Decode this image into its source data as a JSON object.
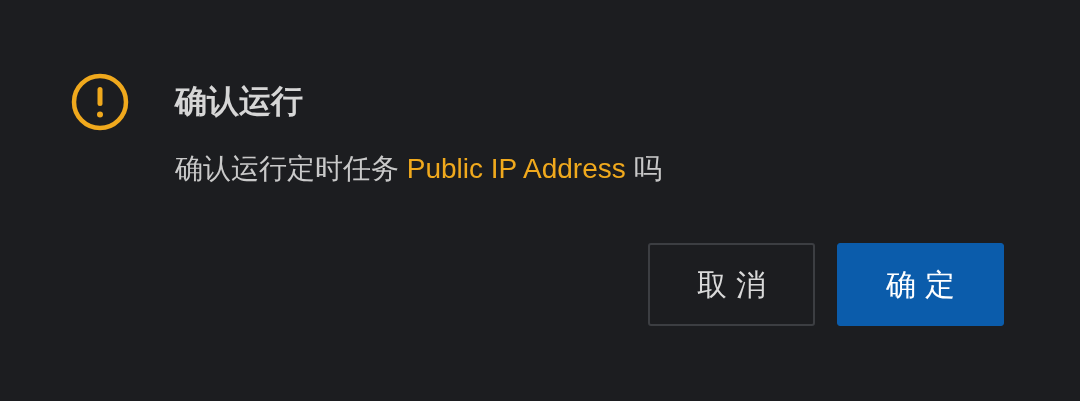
{
  "dialog": {
    "title": "确认运行",
    "message": {
      "before": "确认运行定时任务 ",
      "task": "Public IP Address",
      "after": " 吗"
    },
    "buttons": [
      {
        "label": "取 消",
        "kind": "secondary"
      },
      {
        "label": "确 定",
        "kind": "primary"
      }
    ]
  }
}
